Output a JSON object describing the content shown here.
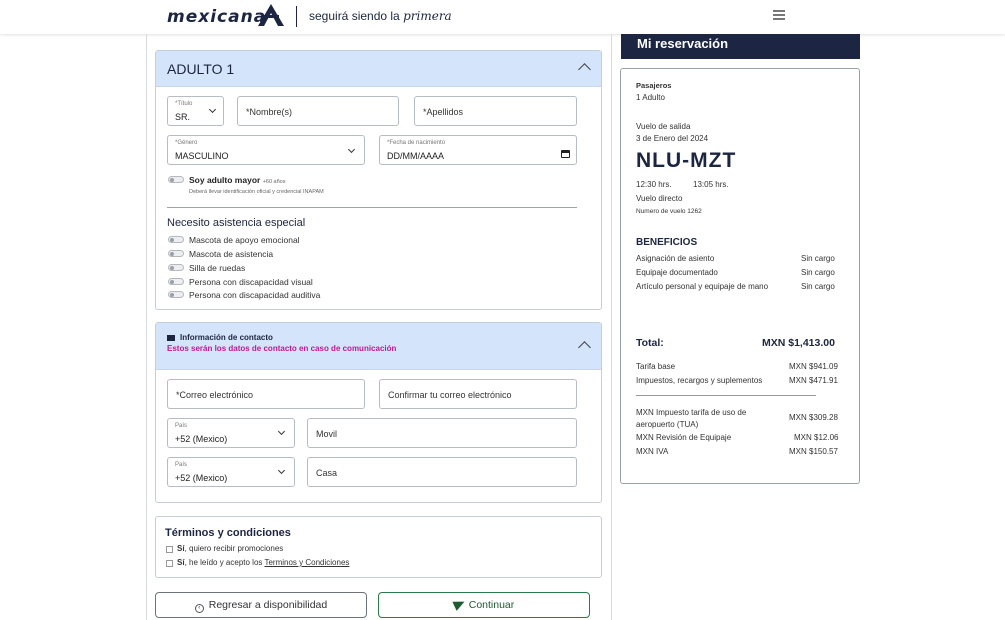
{
  "header": {
    "logo_text": "mexicana",
    "tagline_prefix": "seguirá siendo la",
    "tagline_script": "primera"
  },
  "passenger": {
    "title": "ADULTO 1",
    "titulo_label": "*Título",
    "titulo_value": "SR.",
    "nombre_placeholder": "*Nombre(s)",
    "apellidos_placeholder": "*Apellidos",
    "genero_label": "*Género",
    "genero_value": "MASCULINO",
    "fecha_label": "*Fecha de nacimiento",
    "fecha_placeholder": "DD/MM/AAAA",
    "senior_label": "Soy adulto mayor",
    "senior_age": "+60 años",
    "senior_note": "Deberá llevar identificación oficial y credencial INAPAM",
    "assist_title": "Necesito asistencia especial",
    "assist_options": [
      "Mascota de apoyo emocional",
      "Mascota de asistencia",
      "Silla de ruedas",
      "Persona con discapacidad visual",
      "Persona con discapacidad auditiva"
    ]
  },
  "contact": {
    "title": "Información de contacto",
    "subtitle": "Estos serán los datos de contacto en caso de comunicación",
    "email_placeholder": "*Correo electrónico",
    "email_confirm_placeholder": "Confirmar tu correo electrónico",
    "pais_label": "País",
    "pais_value": "+52 (Mexico)",
    "movil_placeholder": "Movil",
    "casa_placeholder": "Casa"
  },
  "terms": {
    "title": "Términos y condiciones",
    "promo_bold": "Sí",
    "promo_text": ", quiero recibir promociones",
    "accept_bold": "Sí",
    "accept_text": ", he leído y acepto los",
    "accept_link": "Terminos y Condiciones"
  },
  "buttons": {
    "back": "Regresar a disponibilidad",
    "next": "Continuar"
  },
  "reservation": {
    "title": "Mi reservación",
    "pasajeros_label": "Pasajeros",
    "pasajeros_value": "1 Adulto",
    "vuelo_label": "Vuelo de salida",
    "vuelo_fecha": "3 de Enero del 2024",
    "route": "NLU-MZT",
    "salida": "12:30 hrs.",
    "llegada": "13:05 hrs.",
    "tipo": "Vuelo directo",
    "numero": "Numero de vuelo 1262",
    "beneficios_title": "BENEFICIOS",
    "beneficios": [
      {
        "name": "Asignación de asiento",
        "value": "Sin cargo"
      },
      {
        "name": "Equipaje documentado",
        "value": "Sin cargo"
      },
      {
        "name": "Artículo personal y equipaje de mano",
        "value": "Sin cargo"
      }
    ],
    "total_label": "Total:",
    "total_value": "MXN $1,413.00",
    "breakdown": [
      {
        "name": "Tarifa base",
        "value": "MXN $941.09"
      },
      {
        "name": "Impuestos, recargos y suplementos",
        "value": "MXN $471.91"
      }
    ],
    "taxes": [
      {
        "name": "MXN Impuesto tarifa de uso de aeropuerto (TUA)",
        "value": "MXN $309.28"
      },
      {
        "name": "MXN Revisión de Equipaje",
        "value": "MXN $12.06"
      },
      {
        "name": "MXN IVA",
        "value": "MXN $150.57"
      }
    ]
  }
}
